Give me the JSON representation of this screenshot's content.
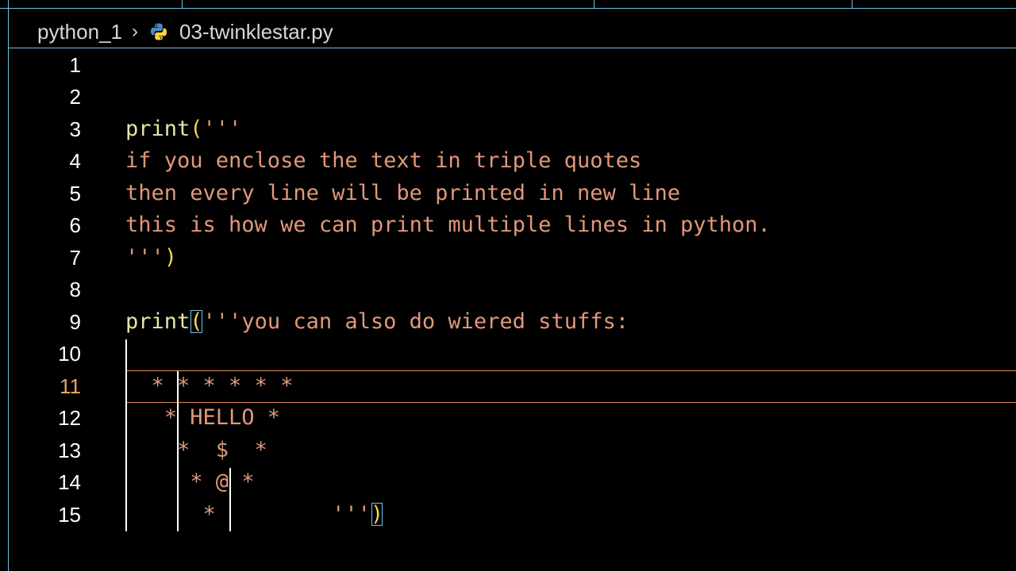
{
  "breadcrumb": {
    "folder": "python_1",
    "file": "03-twinklestar.py",
    "file_icon": "python-file-icon"
  },
  "editor": {
    "active_line": 11,
    "line_numbers": [
      "1",
      "2",
      "3",
      "4",
      "5",
      "6",
      "7",
      "8",
      "9",
      "10",
      "11",
      "12",
      "13",
      "14",
      "15"
    ],
    "lines": {
      "l3_fn": "print",
      "l3_paren": "(",
      "l3_str": "'''",
      "l4": "if you enclose the text in triple quotes",
      "l5": "then every line will be printed in new line",
      "l6": "this is how we can print multiple lines in python.",
      "l7_str": "'''",
      "l7_paren": ")",
      "l9_fn": "print",
      "l9_paren": "(",
      "l9_str": "'''you can also do wiered stuffs:",
      "l11": "  * * * * * *",
      "l12": "   * HELLO *",
      "l13": "    *  $  *",
      "l14": "     * @ *",
      "l15_str": "      *         '''",
      "l15_paren": ")"
    }
  },
  "colors": {
    "background": "#000000",
    "accent": "#6fc3df",
    "string": "#e0987a",
    "function": "#e6e6a8",
    "paren": "#f2d34f",
    "active_line": "#e58a4a"
  }
}
